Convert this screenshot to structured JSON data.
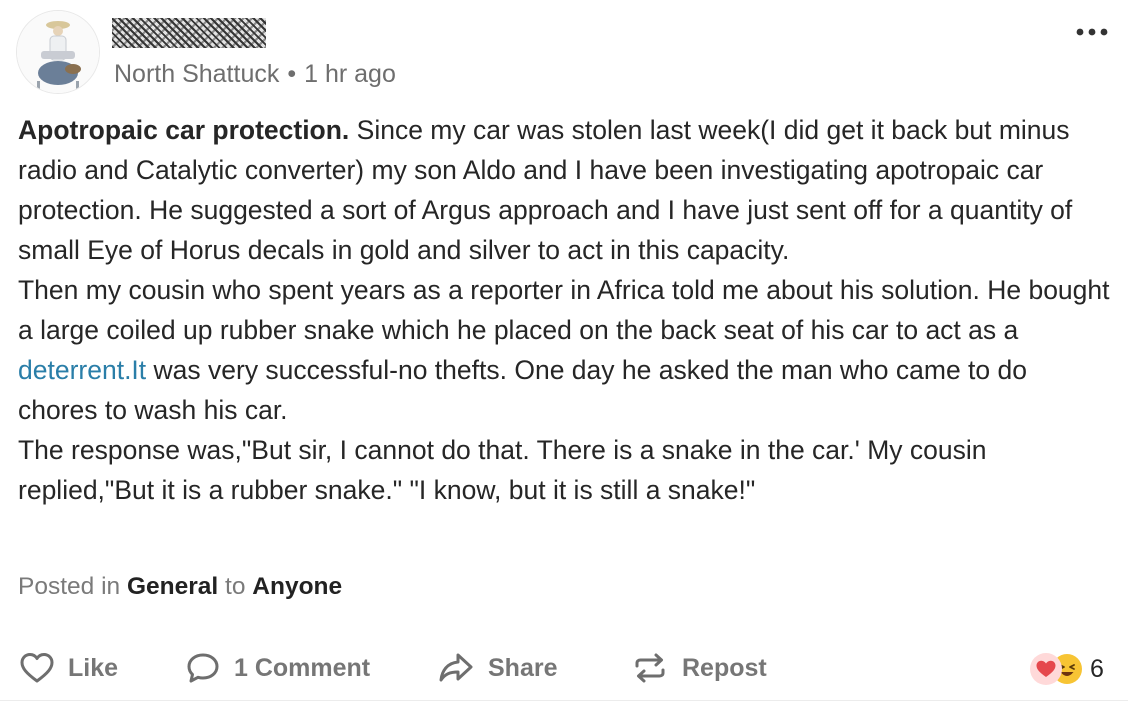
{
  "post": {
    "author_name": "",
    "neighborhood": "North Shattuck",
    "separator": "•",
    "time": "1 hr ago",
    "title": "Apotropaic car protection.",
    "paragraph1_after_title": " Since my car was stolen last week(I did get it back but minus radio and Catalytic converter) my son Aldo and I have been investigating apotropaic car protection. He suggested a sort of Argus approach and I have just sent off for a quantity of small Eye of Horus decals in gold and silver to act in this capacity.",
    "paragraph2_before_link": "Then my cousin who spent years as a reporter in Africa told me about his solution. He bought a large coiled up rubber snake which he placed on the back seat of his car to act as a ",
    "paragraph2_link": "deterrent.It",
    "paragraph2_after_link": " was very successful-no thefts. One day  he asked the man who came to do chores to wash his car.",
    "paragraph3": "The response was,\"But sir, I cannot do that. There is a snake in the car.' My cousin replied,\"But it is a rubber snake.\" \"I know, but it is still a snake!\"",
    "posted_in_prefix": "Posted in",
    "category": "General",
    "to_word": "to",
    "audience": "Anyone"
  },
  "actions": {
    "like_label": "Like",
    "comment_label": "1 Comment",
    "share_label": "Share",
    "repost_label": "Repost",
    "reaction_count": "6"
  },
  "icons": {
    "more": "more-horizontal-icon",
    "like": "heart-outline-icon",
    "comment": "speech-bubble-icon",
    "share": "share-arrow-icon",
    "repost": "repost-arrows-icon",
    "reaction_heart": "heart-reaction-icon",
    "reaction_laugh": "laughing-face-reaction-icon"
  },
  "colors": {
    "link": "#2a7ea8",
    "muted": "#767676",
    "text": "#262626",
    "heart": "#e5484d",
    "laugh": "#f7c434"
  }
}
